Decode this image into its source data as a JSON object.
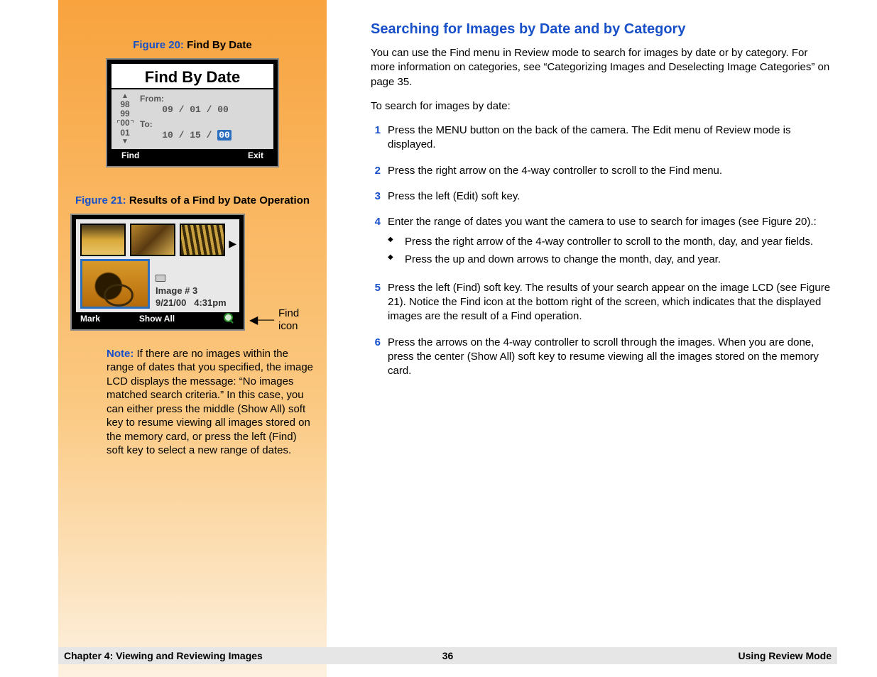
{
  "sidebar": {
    "figure20": {
      "label": "Figure 20:",
      "caption": "Find By Date",
      "lcd_title": "Find By Date",
      "from_label": "From:",
      "to_label": "To:",
      "from_date_mm": "09",
      "from_date_dd": "01",
      "from_date_yy": "00",
      "to_date_mm": "10",
      "to_date_dd": "15",
      "to_date_yy": "00",
      "roller_vals": [
        "98",
        "99",
        "00",
        "01"
      ],
      "softkey_left": "Find",
      "softkey_right": "Exit"
    },
    "figure21": {
      "label": "Figure 21:",
      "caption": "Results of a Find by Date Operation",
      "image_label": "Image # 3",
      "image_date": "9/21/00",
      "image_time": "4:31pm",
      "softkey_left": "Mark",
      "softkey_center": "Show All",
      "callout": "Find icon"
    },
    "note": {
      "label": "Note:",
      "text": "If there are no images within the range of dates that you specified, the image LCD displays the message: “No images matched search criteria.” In this case, you can either press the middle (Show All) soft key to resume viewing all images stored on the memory card, or press the left (Find) soft key to select a new range of dates."
    }
  },
  "main": {
    "heading": "Searching for Images by Date and by Category",
    "intro": "You can use the Find menu in Review mode to search for images by date or by category. For more information on categories, see “Categorizing Images and Deselecting Image Categories” on page 35.",
    "lead": "To search for images by date:",
    "steps": [
      {
        "n": "1",
        "text": "Press the MENU button on the back of the camera. The Edit menu of Review mode is displayed."
      },
      {
        "n": "2",
        "text": "Press the right arrow on the 4-way controller to scroll to the Find menu."
      },
      {
        "n": "3",
        "text": "Press the left (Edit) soft key."
      },
      {
        "n": "4",
        "text": "Enter the range of dates you want the camera to use to search for images (see Figure 20).:",
        "sub": [
          "Press the right arrow of the 4-way controller to scroll to the month, day, and year fields.",
          "Press the up and down arrows to change the month, day, and year."
        ]
      },
      {
        "n": "5",
        "text": "Press the left (Find) soft key. The results of your search appear on the image LCD (see Figure 21). Notice the Find icon at the bottom right of the screen, which indicates that the displayed images are the result of a Find operation."
      },
      {
        "n": "6",
        "text": "Press the arrows on the 4-way controller to scroll through the images. When you are done, press the center (Show All) soft key to resume viewing all the images stored on the memory card."
      }
    ]
  },
  "footer": {
    "left": "Chapter 4: Viewing and Reviewing Images",
    "center": "36",
    "right": "Using Review Mode"
  }
}
